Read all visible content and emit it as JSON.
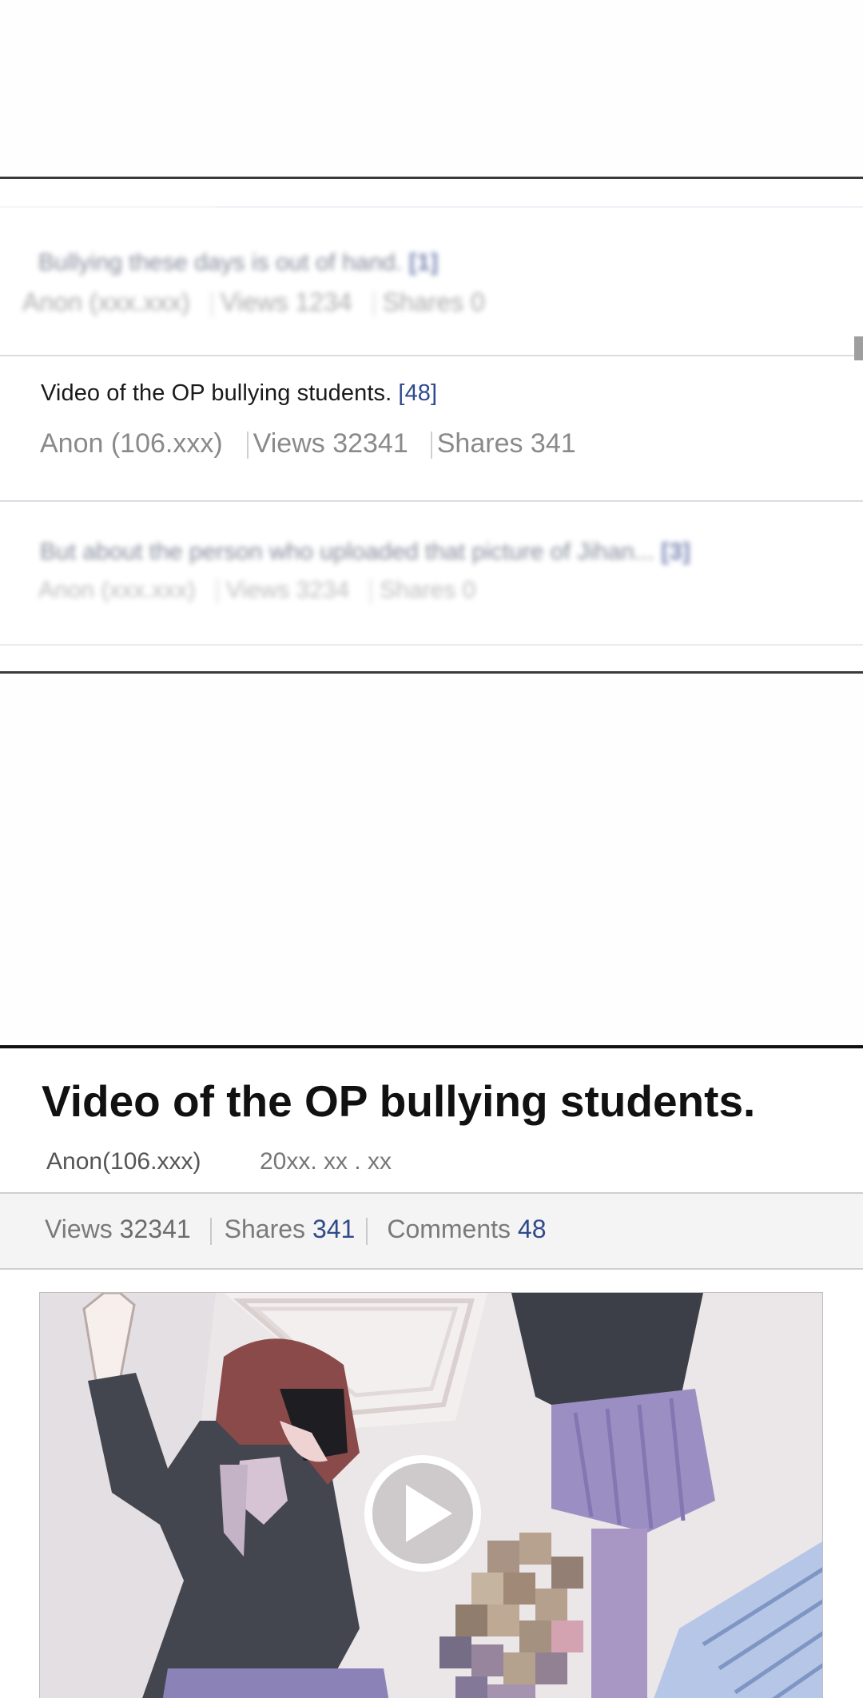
{
  "post_list": {
    "rows": [
      {
        "title": "Bullying these days is out of hand.",
        "comments": "[1]",
        "author": "Anon (xxx.xxx)",
        "views": "Views 1234",
        "shares": "Shares 0"
      },
      {
        "title": "Video of the OP bullying students.",
        "comments": "[48]",
        "author": "Anon (106.xxx)",
        "views": "Views   32341",
        "shares": "Shares 341"
      },
      {
        "title": "But about the person who uploaded that picture of Jihan...",
        "comments": "[3]",
        "author": "Anon (xxx.xxx)",
        "views": "Views 3234",
        "shares": "Shares 0"
      }
    ]
  },
  "post_detail": {
    "title": "Video of the OP bullying students.",
    "author": "Anon(106.xxx)",
    "date": "20xx. xx . xx",
    "stats": {
      "views_label": "Views",
      "views_value": "32341",
      "shares_label": "Shares",
      "shares_value": "341",
      "comments_label": "Comments",
      "comments_value": "48"
    }
  },
  "colors": {
    "link_blue": "#2f4a8a",
    "border_dark": "#111111",
    "stats_bg": "#f4f4f4"
  },
  "icons": {
    "video_play": "play-icon"
  }
}
